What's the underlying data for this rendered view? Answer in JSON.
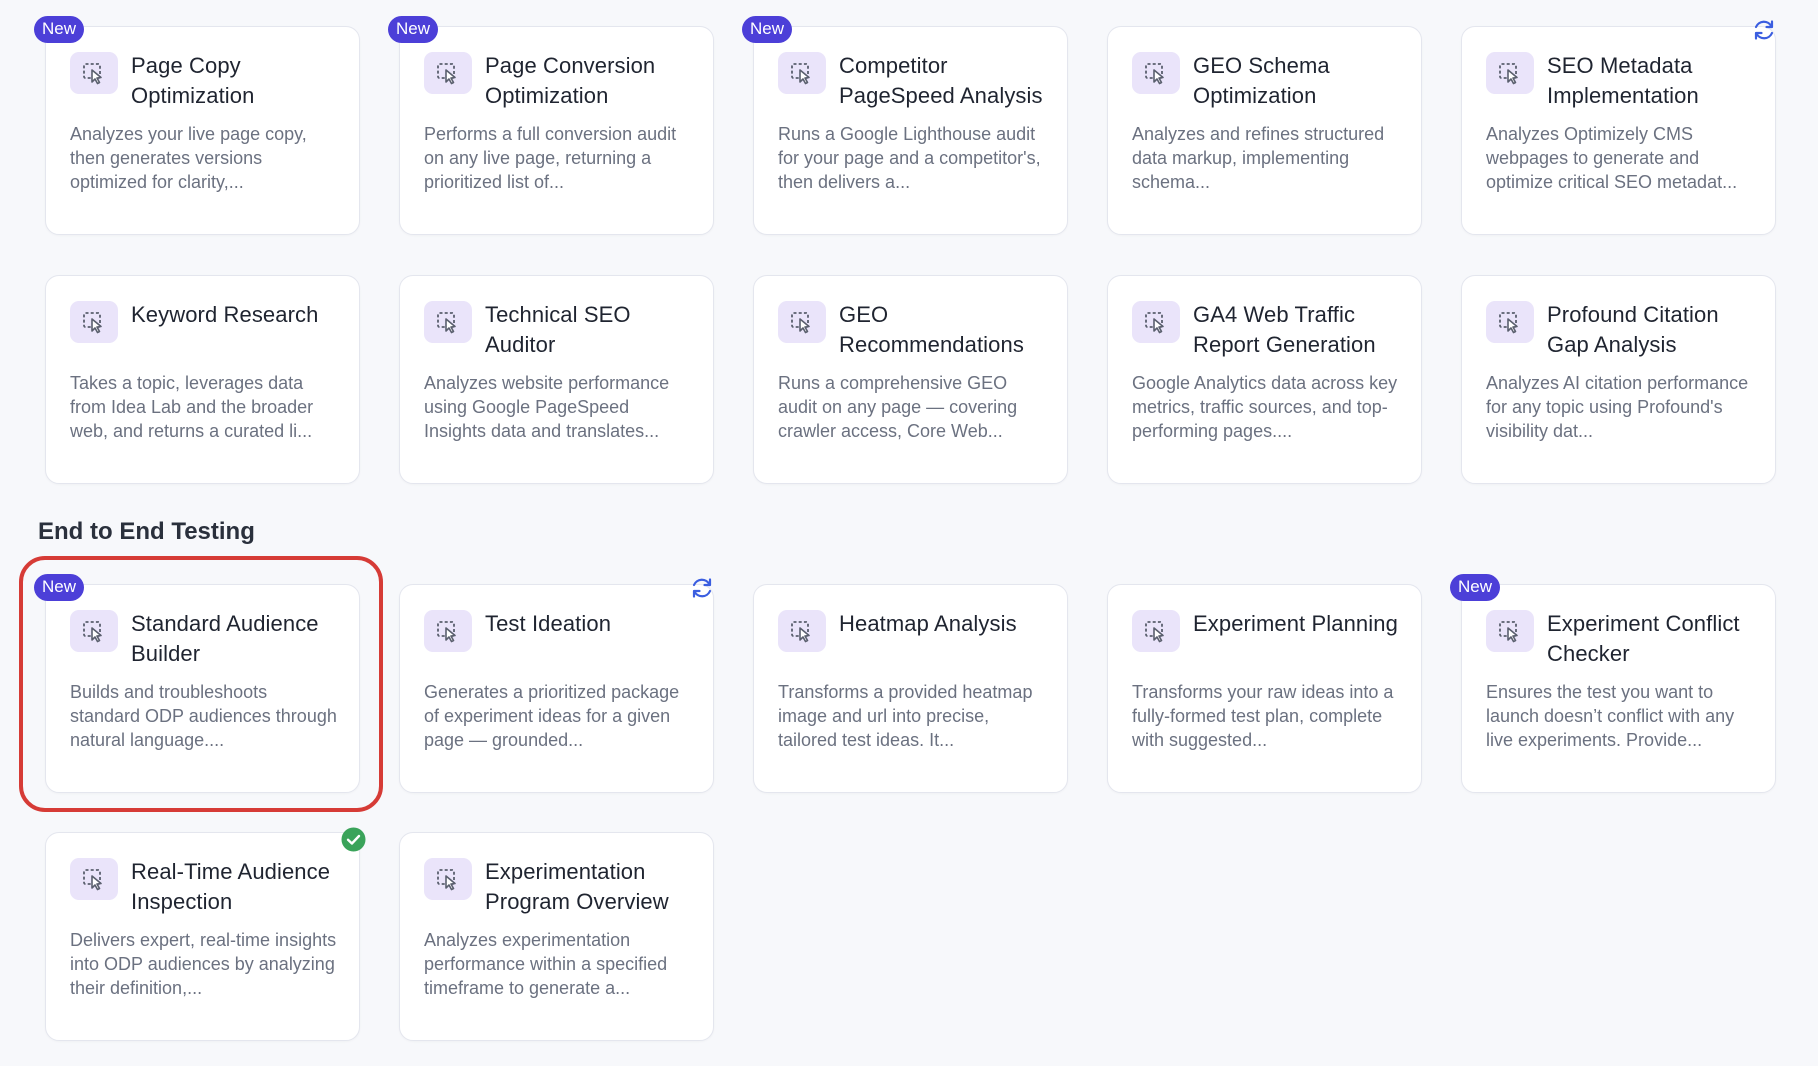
{
  "theme": {
    "badge_color": "#4c3fd8",
    "icon_bg": "#eae4fa",
    "refresh_color": "#3b5ee0",
    "check_color": "#3aa35a",
    "highlight_color": "#d63b36"
  },
  "section": {
    "title": "End to End Testing"
  },
  "cards": [
    {
      "title": "Page Copy Optimization",
      "desc": "Analyzes your live page copy, then generates versions optimized for clarity,...",
      "badge": "New"
    },
    {
      "title": "Page Conversion Optimization",
      "desc": "Performs a full conversion audit on any live page, returning a prioritized list of...",
      "badge": "New"
    },
    {
      "title": "Competitor PageSpeed Analysis",
      "desc": "Runs a Google Lighthouse audit for your page and a competitor's, then delivers a...",
      "badge": "New"
    },
    {
      "title": "GEO Schema Optimization",
      "desc": "Analyzes and refines structured data markup, implementing schema..."
    },
    {
      "title": "SEO Metadata Implementation",
      "desc": "Analyzes Optimizely CMS webpages to generate and optimize critical SEO metadat...",
      "status_icon": "refresh-icon"
    },
    {
      "title": "Keyword Research",
      "desc": "Takes a topic, leverages data from Idea Lab and the broader web, and returns a curated li..."
    },
    {
      "title": "Technical SEO Auditor",
      "desc": "Analyzes website performance using Google PageSpeed Insights data and translates..."
    },
    {
      "title": "GEO Recommendations",
      "desc": "Runs a comprehensive GEO audit on any page — covering crawler access, Core Web..."
    },
    {
      "title": "GA4 Web Traffic Report Generation",
      "desc": "Google Analytics data across key metrics, traffic sources, and top-performing pages...."
    },
    {
      "title": "Profound Citation Gap Analysis",
      "desc": "Analyzes AI citation performance for any topic using Profound's visibility dat..."
    },
    {
      "title": "Standard Audience Builder",
      "desc": "Builds and troubleshoots standard ODP audiences through natural language....",
      "badge": "New",
      "highlighted": true
    },
    {
      "title": "Test Ideation",
      "desc": "Generates a prioritized package of experiment ideas for a given page — grounded...",
      "status_icon": "refresh-icon"
    },
    {
      "title": "Heatmap Analysis",
      "desc": "Transforms a provided heatmap image and url into precise, tailored test ideas. It..."
    },
    {
      "title": "Experiment Planning",
      "desc": "Transforms your raw ideas into a fully-formed test plan, complete with suggested..."
    },
    {
      "title": "Experiment Conflict Checker",
      "desc": "Ensures the test you want to launch doesn’t conflict with any live experiments. Provide...",
      "badge": "New"
    },
    {
      "title": "Real-Time Audience Inspection",
      "desc": "Delivers expert, real-time insights into ODP audiences by analyzing their definition,...",
      "status_icon": "check-circle-icon"
    },
    {
      "title": "Experimentation Program Overview",
      "desc": "Analyzes experimentation performance within a specified timeframe to generate a..."
    }
  ]
}
